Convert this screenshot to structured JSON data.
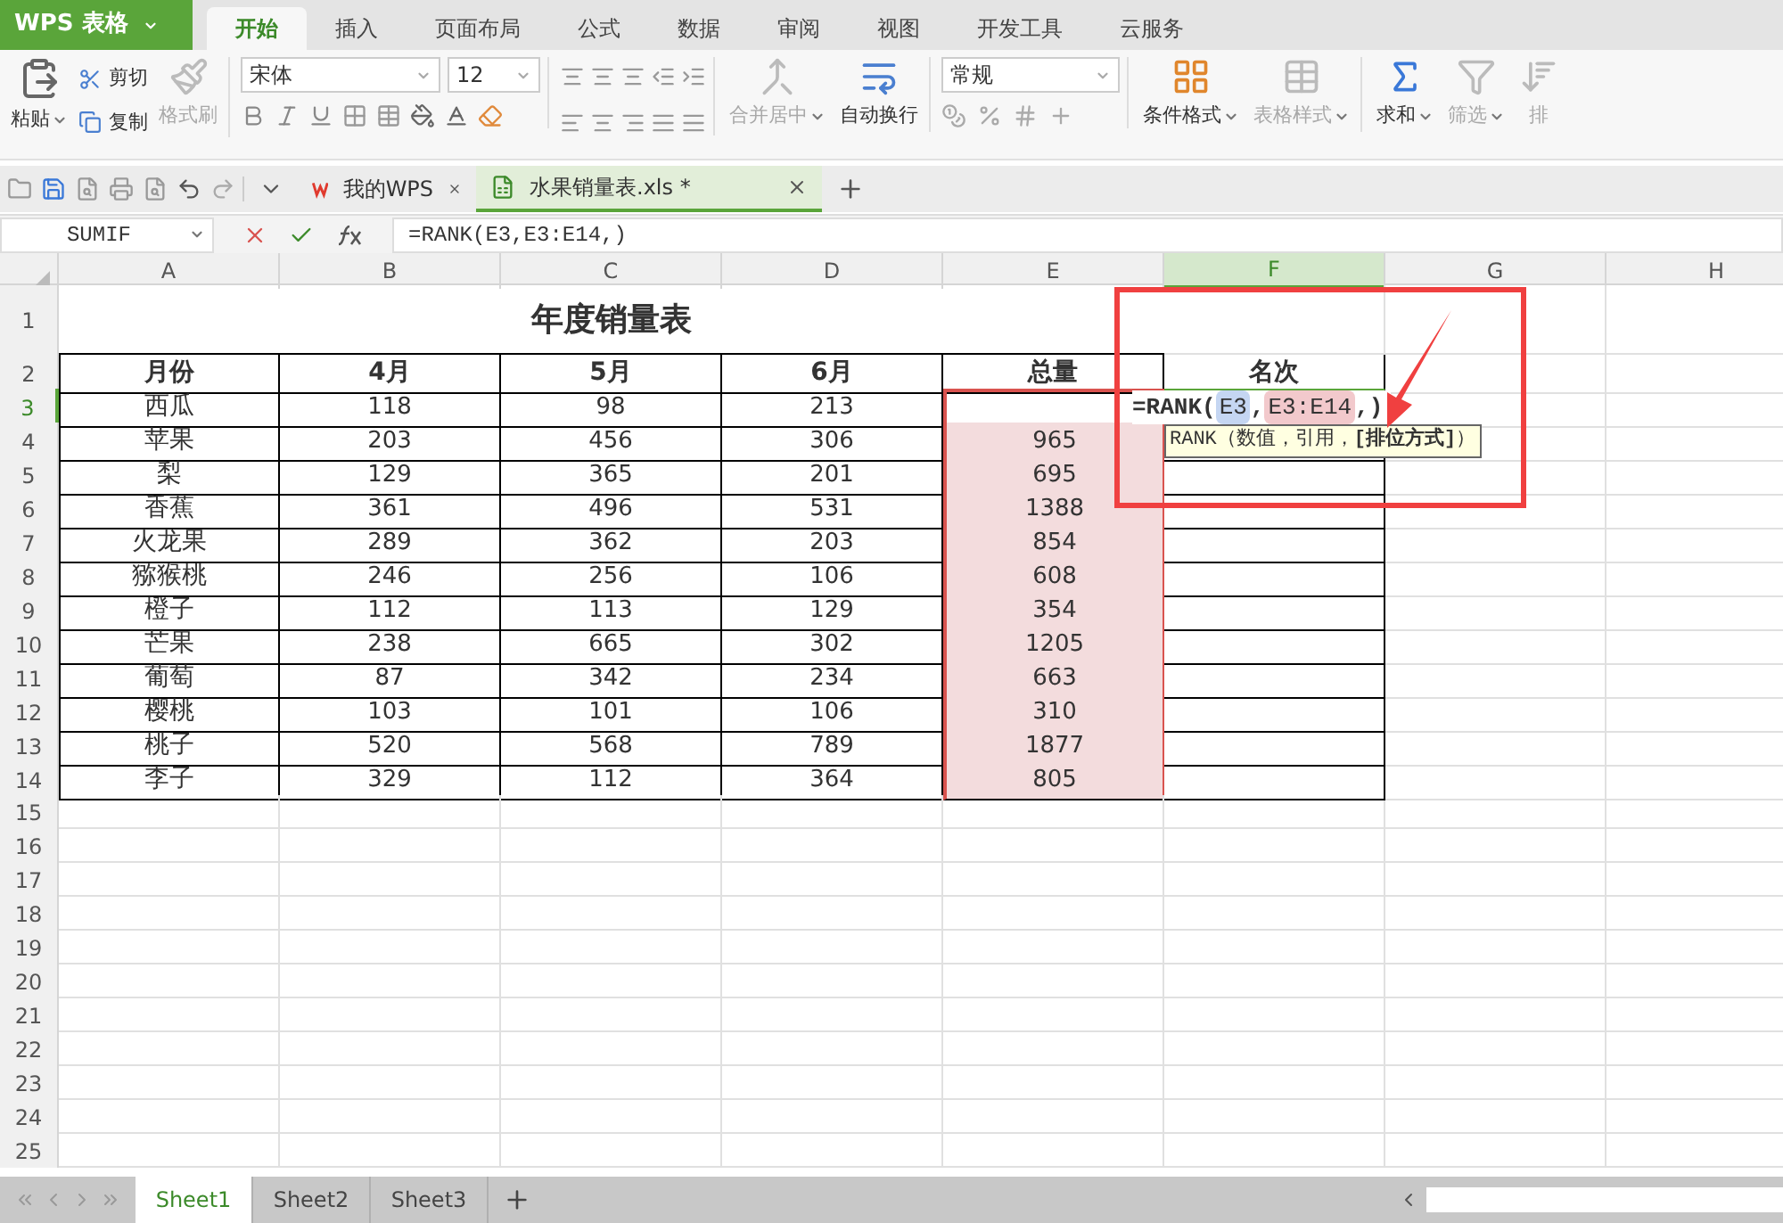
{
  "app_menu": {
    "label": "WPS 表格"
  },
  "ribbon_tabs": [
    {
      "label": "开始",
      "selected": true
    },
    {
      "label": "插入",
      "selected": false
    },
    {
      "label": "页面布局",
      "selected": false
    },
    {
      "label": "公式",
      "selected": false
    },
    {
      "label": "数据",
      "selected": false
    },
    {
      "label": "审阅",
      "selected": false
    },
    {
      "label": "视图",
      "selected": false
    },
    {
      "label": "开发工具",
      "selected": false
    },
    {
      "label": "云服务",
      "selected": false
    }
  ],
  "clipboard": {
    "paste": "粘贴",
    "cut": "剪切",
    "copy": "复制",
    "format_painter": {
      "label": "格式刷",
      "disabled": true
    }
  },
  "font": {
    "name": "宋体",
    "size": "12"
  },
  "alignment": {
    "merge": {
      "label": "合并居中",
      "disabled": true
    },
    "wrap": {
      "label": "自动换行",
      "disabled": false
    }
  },
  "number_format": {
    "value": "常规"
  },
  "styles": [
    {
      "label": "条件格式",
      "disabled": false
    },
    {
      "label": "表格样式",
      "disabled": true
    }
  ],
  "editing": [
    {
      "label": "求和",
      "disabled": false,
      "kind": "sum"
    },
    {
      "label": "筛选",
      "disabled": true,
      "kind": "filter"
    },
    {
      "label": "排",
      "disabled": true,
      "kind": "sort"
    }
  ],
  "doc_tabs": [
    {
      "label": "我的WPS",
      "selected": false,
      "kind": "home"
    },
    {
      "label": "水果销量表.xls *",
      "selected": true,
      "kind": "sheet"
    }
  ],
  "name_box": {
    "value": "SUMIF"
  },
  "formula_bar": {
    "value": "=RANK(E3,E3:E14,)"
  },
  "columns": [
    {
      "label": "A",
      "selected": false
    },
    {
      "label": "B",
      "selected": false
    },
    {
      "label": "C",
      "selected": false
    },
    {
      "label": "D",
      "selected": false
    },
    {
      "label": "E",
      "selected": false
    },
    {
      "label": "F",
      "selected": true
    },
    {
      "label": "G",
      "selected": false
    },
    {
      "label": "H",
      "selected": false
    }
  ],
  "row_numbers": [
    {
      "label": "1",
      "selected": false
    },
    {
      "label": "2",
      "selected": false
    },
    {
      "label": "3",
      "selected": true
    },
    {
      "label": "4",
      "selected": false
    },
    {
      "label": "5",
      "selected": false
    },
    {
      "label": "6",
      "selected": false
    },
    {
      "label": "7",
      "selected": false
    },
    {
      "label": "8",
      "selected": false
    },
    {
      "label": "9",
      "selected": false
    },
    {
      "label": "10",
      "selected": false
    },
    {
      "label": "11",
      "selected": false
    },
    {
      "label": "12",
      "selected": false
    },
    {
      "label": "13",
      "selected": false
    },
    {
      "label": "14",
      "selected": false
    },
    {
      "label": "15",
      "selected": false
    },
    {
      "label": "16",
      "selected": false
    },
    {
      "label": "17",
      "selected": false
    },
    {
      "label": "18",
      "selected": false
    },
    {
      "label": "19",
      "selected": false
    },
    {
      "label": "20",
      "selected": false
    },
    {
      "label": "21",
      "selected": false
    },
    {
      "label": "22",
      "selected": false
    },
    {
      "label": "23",
      "selected": false
    },
    {
      "label": "24",
      "selected": false
    },
    {
      "label": "25",
      "selected": false
    }
  ],
  "sheet_title": "年度销量表",
  "header": [
    "月份",
    "4月",
    "5月",
    "6月",
    "总量",
    "名次"
  ],
  "rows": [
    {
      "fruit": "西瓜",
      "apr": "118",
      "may": "98",
      "jun": "213",
      "editing": true
    },
    {
      "fruit": "苹果",
      "apr": "203",
      "may": "456",
      "jun": "306",
      "total": "965",
      "editing": false
    },
    {
      "fruit": "梨",
      "apr": "129",
      "may": "365",
      "jun": "201",
      "total": "695",
      "editing": false
    },
    {
      "fruit": "香蕉",
      "apr": "361",
      "may": "496",
      "jun": "531",
      "total": "1388",
      "editing": false
    },
    {
      "fruit": "火龙果",
      "apr": "289",
      "may": "362",
      "jun": "203",
      "total": "854",
      "editing": false
    },
    {
      "fruit": "猕猴桃",
      "apr": "246",
      "may": "256",
      "jun": "106",
      "total": "608",
      "editing": false
    },
    {
      "fruit": "橙子",
      "apr": "112",
      "may": "113",
      "jun": "129",
      "total": "354",
      "editing": false
    },
    {
      "fruit": "芒果",
      "apr": "238",
      "may": "665",
      "jun": "302",
      "total": "1205",
      "editing": false
    },
    {
      "fruit": "葡萄",
      "apr": "87",
      "may": "342",
      "jun": "234",
      "total": "663",
      "editing": false
    },
    {
      "fruit": "樱桃",
      "apr": "103",
      "may": "101",
      "jun": "106",
      "total": "310",
      "editing": false
    },
    {
      "fruit": "桃子",
      "apr": "520",
      "may": "568",
      "jun": "789",
      "total": "1877",
      "editing": false
    },
    {
      "fruit": "李子",
      "apr": "329",
      "may": "112",
      "jun": "364",
      "total": "805",
      "editing": false
    }
  ],
  "cell_editor": [
    {
      "kind": "text",
      "text": "=RANK("
    },
    {
      "kind": "ref",
      "text": "E3",
      "color": "#c5d6f2"
    },
    {
      "kind": "text",
      "text": ","
    },
    {
      "kind": "ref",
      "text": "E3:E14",
      "color": "#f2c9cc"
    },
    {
      "kind": "text",
      "text": ","
    },
    {
      "kind": "text",
      "text": ")"
    }
  ],
  "tooltip": "RANK（数值，引用，**[排位方式]**）",
  "sheet_tabs": [
    {
      "label": "Sheet1",
      "selected": true
    },
    {
      "label": "Sheet2",
      "selected": false
    },
    {
      "label": "Sheet3",
      "selected": false
    }
  ]
}
